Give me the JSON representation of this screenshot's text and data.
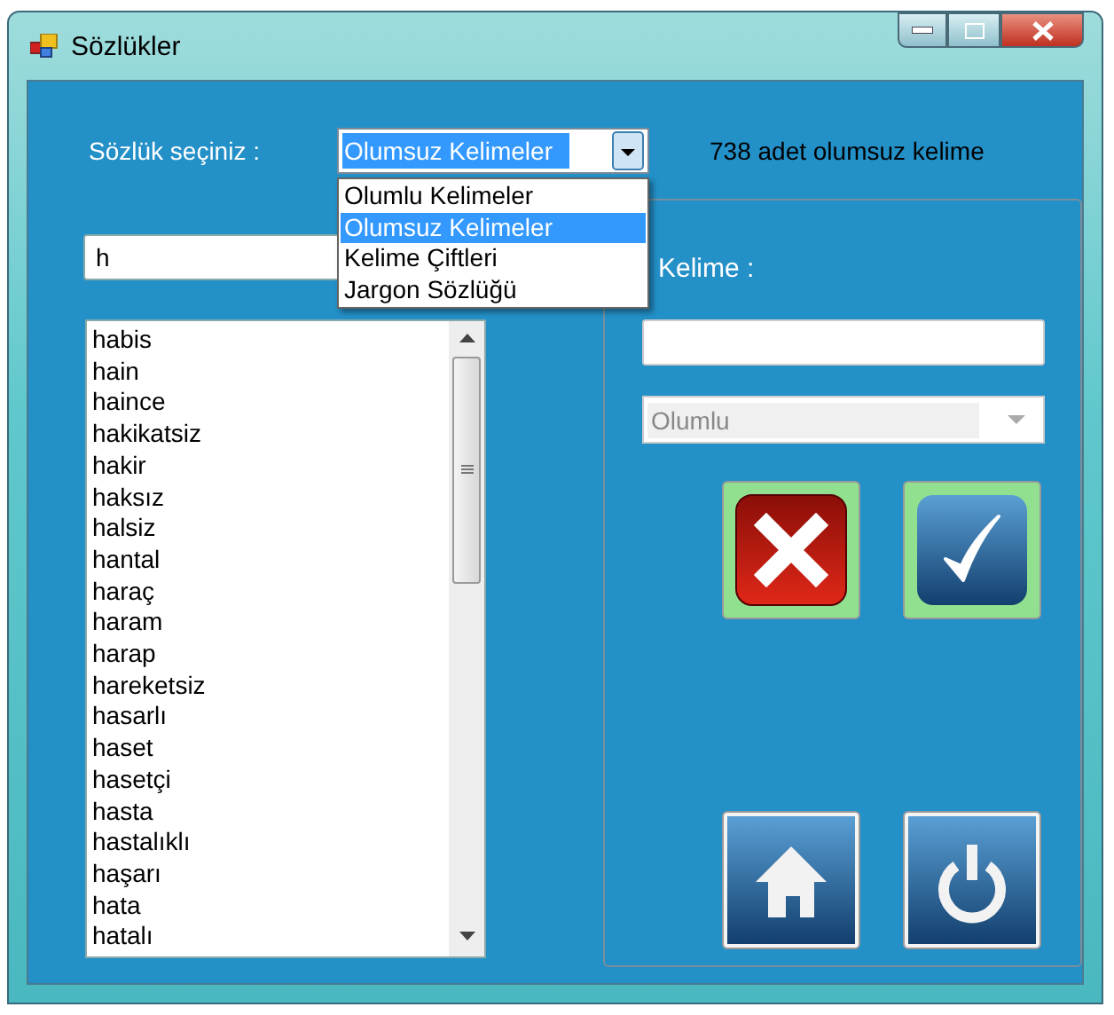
{
  "window": {
    "title": "Sözlükler"
  },
  "dictionary_selector": {
    "label": "Sözlük seçiniz :",
    "value": "Olumsuz Kelimeler",
    "expanded": true,
    "options": [
      {
        "label": "Olumlu Kelimeler",
        "selected": false
      },
      {
        "label": "Olumsuz Kelimeler",
        "selected": true
      },
      {
        "label": "Kelime Çiftleri",
        "selected": false
      },
      {
        "label": "Jargon Sözlüğü",
        "selected": false
      }
    ]
  },
  "word_count": "738 adet olumsuz kelime",
  "search": {
    "value": "h"
  },
  "word_list": [
    "habis",
    "hain",
    "haince",
    "hakikatsiz",
    "hakir",
    "haksız",
    "halsiz",
    "hantal",
    "haraç",
    "haram",
    "harap",
    "hareketsiz",
    "hasarlı",
    "haset",
    "hasetçi",
    "hasta",
    "hastalıklı",
    "haşarı",
    "hata",
    "hatalı"
  ],
  "word_panel": {
    "label": "Kelime :",
    "polarity": {
      "value": "Olumlu",
      "disabled": true
    }
  },
  "buttons": [
    {
      "kind": "delete"
    },
    {
      "kind": "confirm"
    },
    {
      "kind": "home"
    },
    {
      "kind": "power"
    }
  ]
}
